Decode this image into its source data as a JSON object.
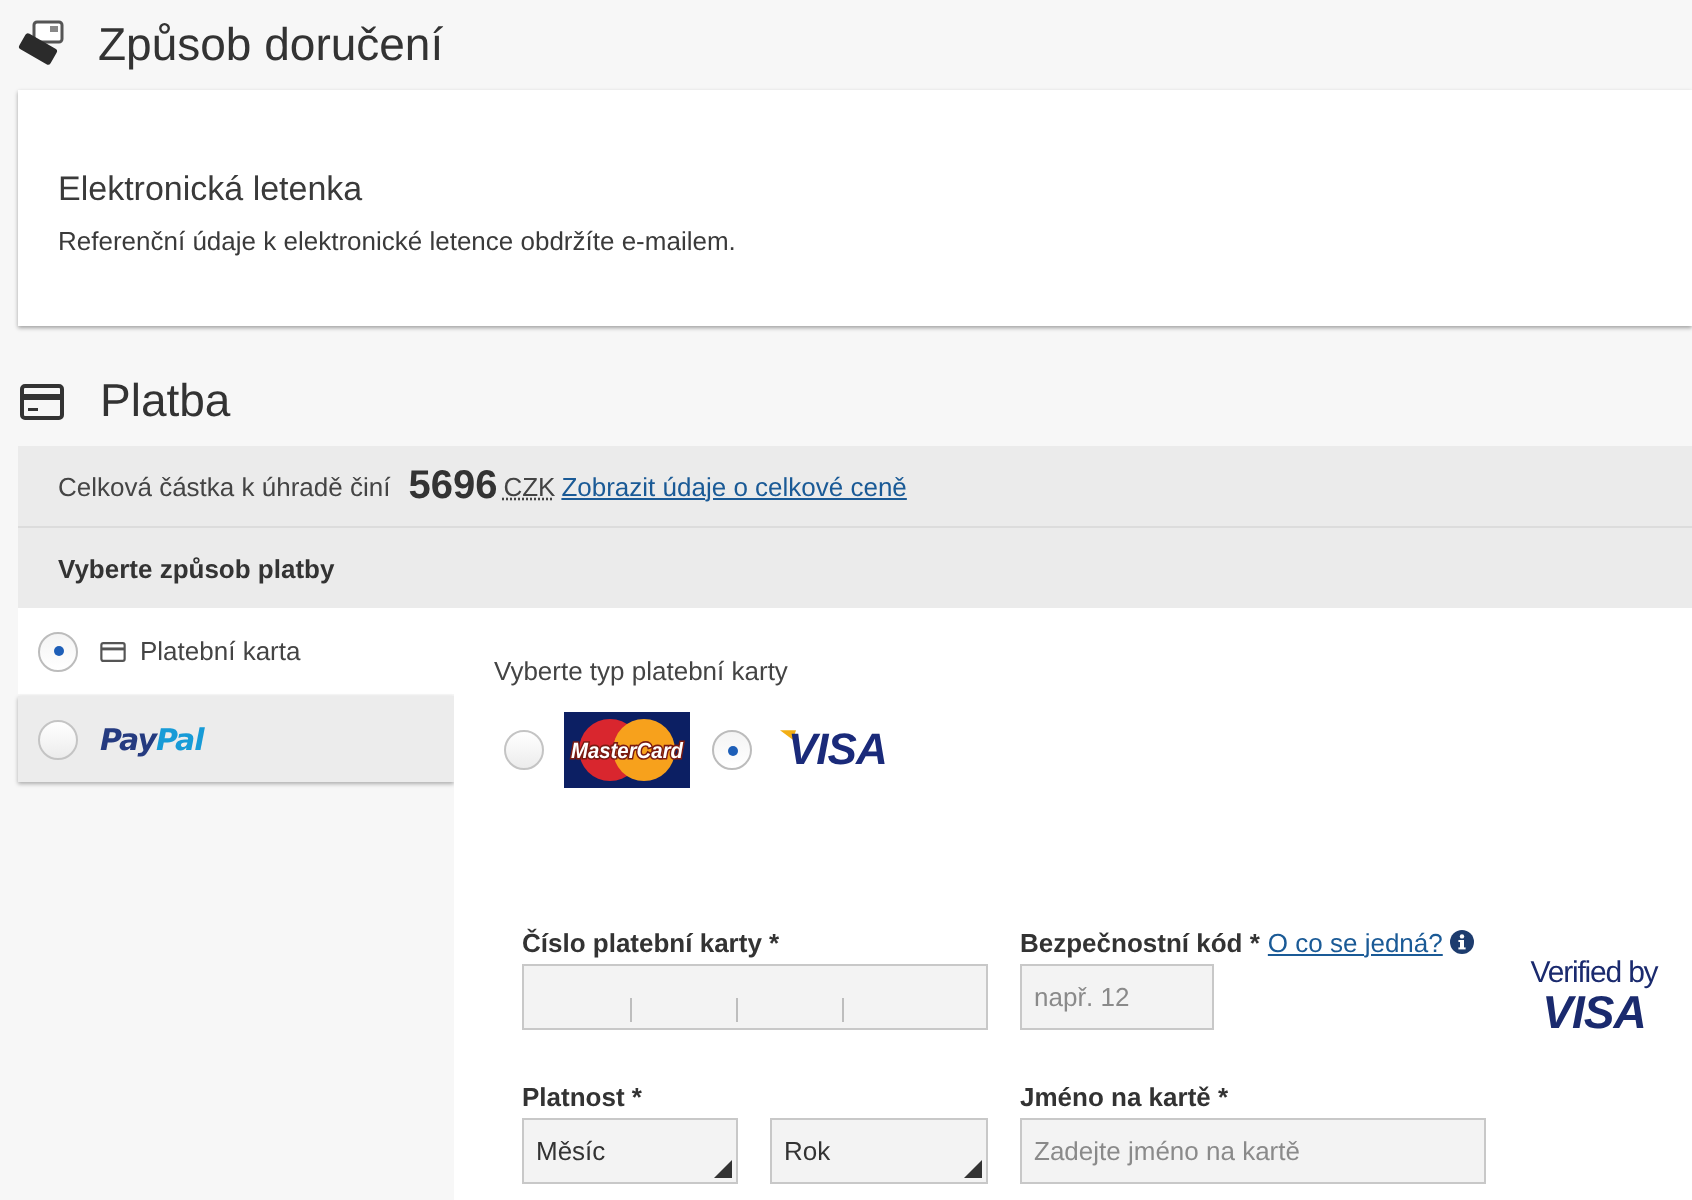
{
  "delivery": {
    "title": "Způsob doručení",
    "option_title": "Elektronická letenka",
    "description": "Referenční údaje k elektronické letence obdržíte e-mailem."
  },
  "payment": {
    "title": "Platba",
    "summary": {
      "total_label": "Celková částka k úhradě činí",
      "amount": "5696",
      "currency": "CZK",
      "details_link": "Zobrazit údaje o celkové ceně",
      "method_prompt": "Vyberte způsob platby"
    },
    "methods": [
      {
        "kind": "card",
        "label": "Platební karta",
        "selected": true
      },
      {
        "kind": "paypal",
        "logo_parts": [
          "Pay",
          "Pal"
        ],
        "selected": false
      }
    ],
    "card_type_prompt": "Vyberte typ platební karty",
    "card_types": [
      {
        "kind": "mastercard",
        "logo_text": "MasterCard",
        "selected": false
      },
      {
        "kind": "visa",
        "logo_text": "VISA",
        "selected": true
      }
    ],
    "fields": [
      {
        "kind": "card_number",
        "label": "Číslo platební karty *"
      },
      {
        "kind": "security_code",
        "label": "Bezpečnostní kód *",
        "help_link": "O co se jedná?",
        "placeholder": "např. 12"
      },
      {
        "kind": "expiry",
        "label": "Platnost *",
        "selects": [
          {
            "value": "Měsíc"
          },
          {
            "value": "Rok"
          }
        ]
      },
      {
        "kind": "name",
        "label": "Jméno na kartě *",
        "placeholder": "Zadejte jméno na kartě"
      }
    ],
    "verified_badge": {
      "line_1": "Verified by",
      "line_2": "VISA"
    }
  }
}
